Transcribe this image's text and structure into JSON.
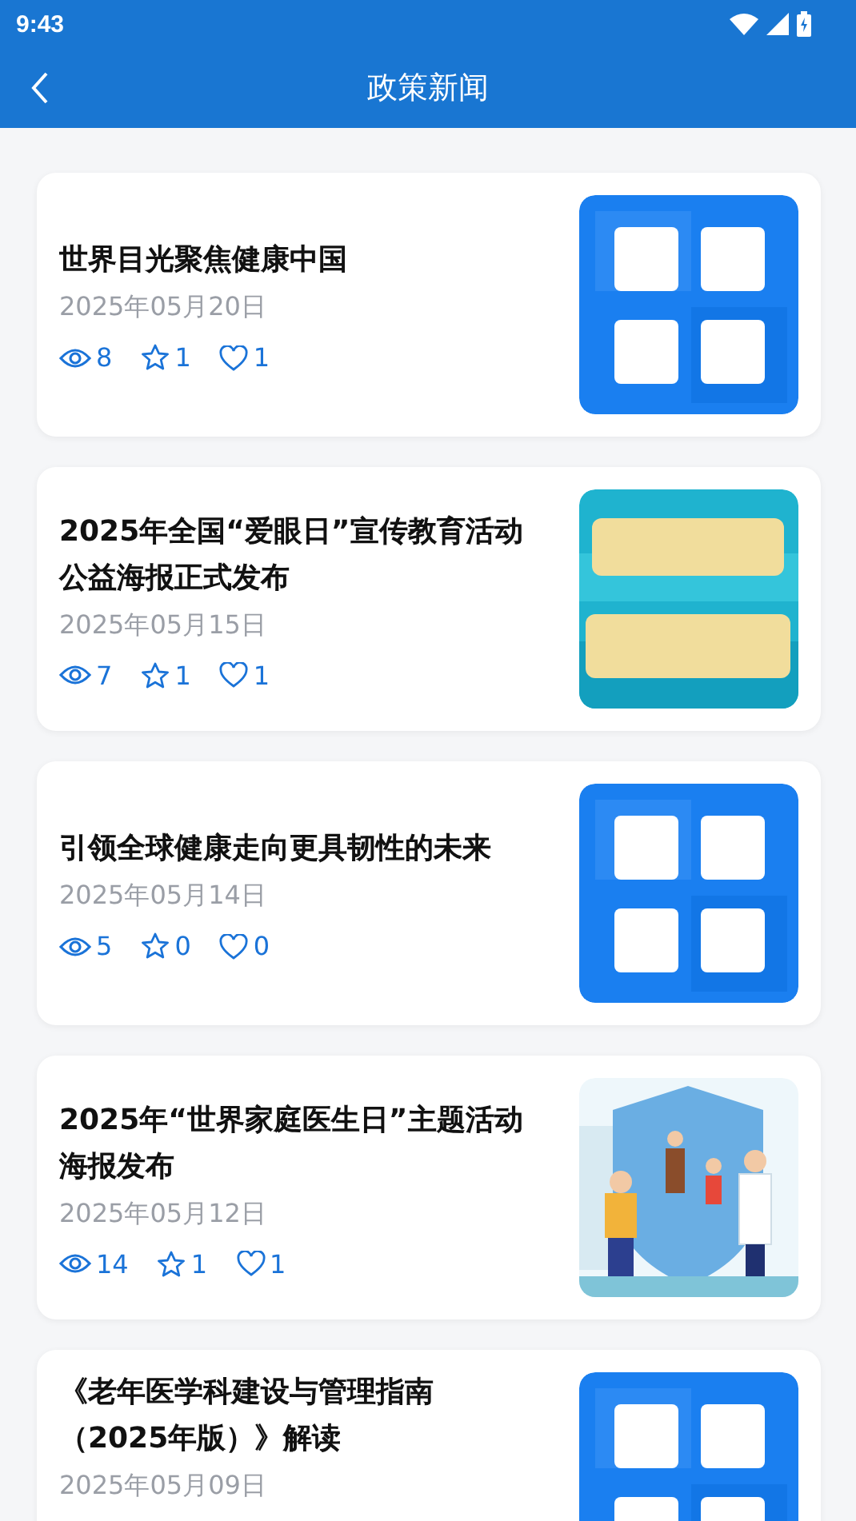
{
  "status_bar": {
    "time": "9:43"
  },
  "header": {
    "title": "政策新闻"
  },
  "news": [
    {
      "title": "世界目光聚焦健康中国",
      "date": "2025年05月20日",
      "views": "8",
      "stars": "1",
      "likes": "1"
    },
    {
      "title": "2025年全国“爱眼日”宣传教育活动公益海报正式发布",
      "date": "2025年05月15日",
      "views": "7",
      "stars": "1",
      "likes": "1"
    },
    {
      "title": "引领全球健康走向更具韧性的未来",
      "date": "2025年05月14日",
      "views": "5",
      "stars": "0",
      "likes": "0"
    },
    {
      "title": "2025年“世界家庭医生日”主题活动海报发布",
      "date": "2025年05月12日",
      "views": "14",
      "stars": "1",
      "likes": "1"
    },
    {
      "title": "《老年医学科建设与管理指南（2025年版）》解读",
      "date": "2025年05月09日"
    }
  ]
}
